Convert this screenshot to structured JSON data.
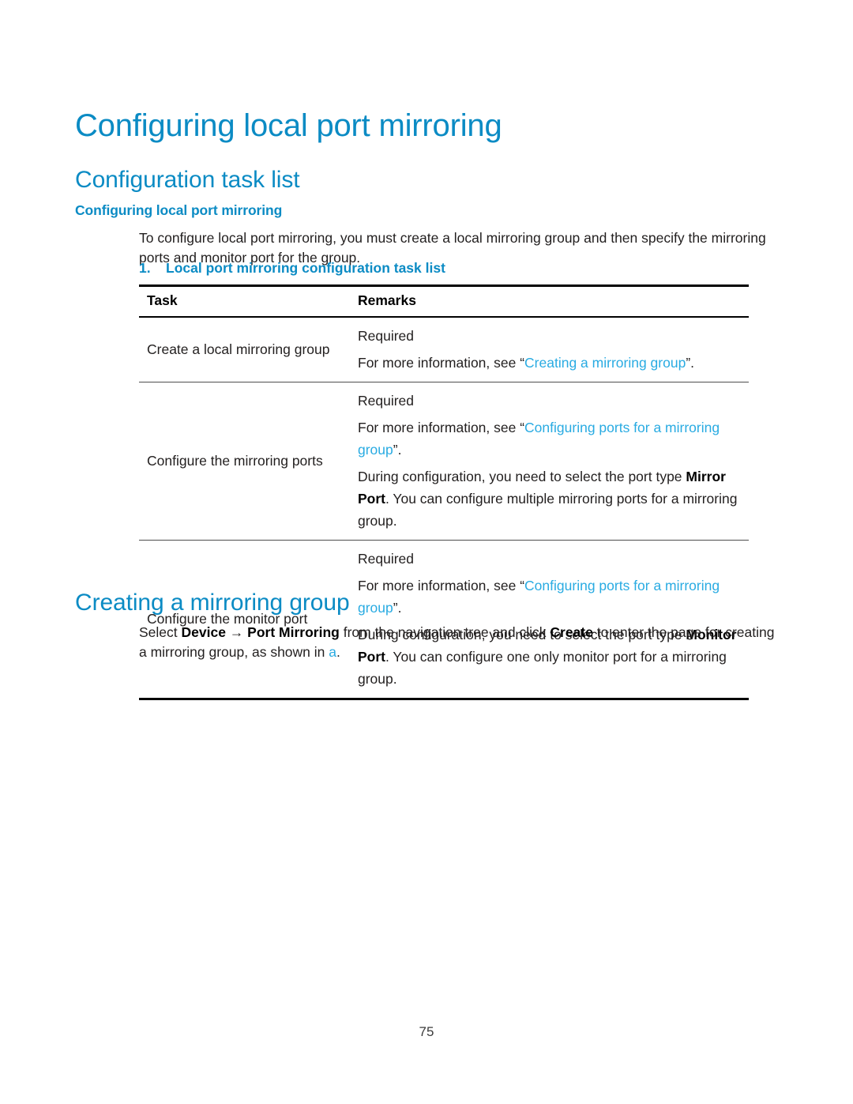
{
  "document": {
    "title": "Configuring local port mirroring",
    "page_number": "75",
    "accent_heading_color": "#0b8bc4",
    "link_color": "#29abe2",
    "body_color": "#221f1f"
  },
  "sections": {
    "h1": "Configuring local port mirroring",
    "task_list": {
      "h2": "Configuration task list",
      "h3": "Configuring local port mirroring",
      "intro": "To configure local port mirroring, you must create a local mirroring group and then specify the mirroring ports and monitor port for the group.",
      "table_caption_number": "1.",
      "table_caption_text": "Local port mirroring configuration task list",
      "table": {
        "headers": [
          "Task",
          "Remarks"
        ],
        "rows": [
          {
            "task": "Create a local mirroring group",
            "remarks": [
              {
                "parts": [
                  {
                    "t": "Required",
                    "style": "plain"
                  }
                ]
              },
              {
                "parts": [
                  {
                    "t": "For more information, see “",
                    "style": "plain"
                  },
                  {
                    "t": "Creating a mirroring group",
                    "style": "link"
                  },
                  {
                    "t": "”.",
                    "style": "plain"
                  }
                ]
              }
            ]
          },
          {
            "task": "Configure the mirroring ports",
            "remarks": [
              {
                "parts": [
                  {
                    "t": "Required",
                    "style": "plain"
                  }
                ]
              },
              {
                "parts": [
                  {
                    "t": "For more information, see “",
                    "style": "plain"
                  },
                  {
                    "t": "Configuring ports for a mirroring group",
                    "style": "link"
                  },
                  {
                    "t": "”.",
                    "style": "plain"
                  }
                ]
              },
              {
                "parts": [
                  {
                    "t": "During configuration, you need to select the port type ",
                    "style": "plain"
                  },
                  {
                    "t": "Mirror Port",
                    "style": "bold"
                  },
                  {
                    "t": ". You can configure multiple mirroring ports for a mirroring group.",
                    "style": "plain"
                  }
                ]
              }
            ]
          },
          {
            "task": "Configure the monitor port",
            "remarks": [
              {
                "parts": [
                  {
                    "t": "Required",
                    "style": "plain"
                  }
                ]
              },
              {
                "parts": [
                  {
                    "t": "For more information, see “",
                    "style": "plain"
                  },
                  {
                    "t": "Configuring ports for a mirroring group",
                    "style": "link"
                  },
                  {
                    "t": "”.",
                    "style": "plain"
                  }
                ]
              },
              {
                "parts": [
                  {
                    "t": "During configuration, you need to select the port type ",
                    "style": "plain"
                  },
                  {
                    "t": "Monitor Port",
                    "style": "bold"
                  },
                  {
                    "t": ". You can configure one only monitor port for a mirroring group.",
                    "style": "plain"
                  }
                ]
              }
            ]
          }
        ]
      }
    },
    "creating_group": {
      "h2": "Creating a mirroring group",
      "paragraph_parts": [
        {
          "t": "Select ",
          "style": "plain"
        },
        {
          "t": "Device",
          "style": "bold"
        },
        {
          "t": " → ",
          "style": "plain"
        },
        {
          "t": "Port Mirroring",
          "style": "bold"
        },
        {
          "t": " from the navigation tree and click ",
          "style": "plain"
        },
        {
          "t": "Create",
          "style": "bold"
        },
        {
          "t": " to enter the page for creating a mirroring group, as shown in ",
          "style": "plain"
        },
        {
          "t": "a",
          "style": "link"
        },
        {
          "t": ".",
          "style": "plain"
        }
      ]
    }
  }
}
